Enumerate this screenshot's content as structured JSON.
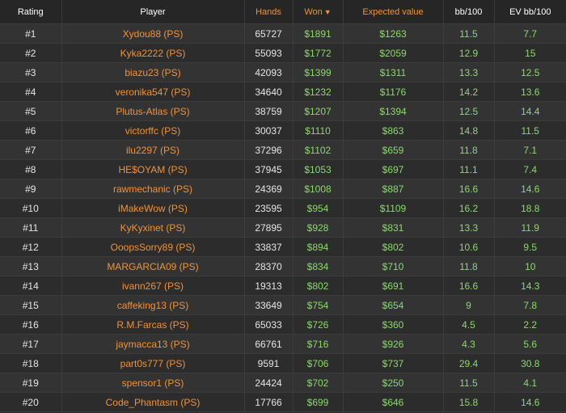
{
  "headers": {
    "rating": "Rating",
    "player": "Player",
    "hands": "Hands",
    "won": "Won",
    "ev": "Expected value",
    "bb100": "bb/100",
    "evbb100": "EV bb/100"
  },
  "sort_arrow_icon": "caret-down-icon",
  "colors": {
    "accent_orange": "#f0923c",
    "value_green": "#8ad96b",
    "background": "#2b2b2b"
  },
  "rows": [
    {
      "rank": "#1",
      "player": "Xydou88 (PS)",
      "hands": "65727",
      "won": "$1891",
      "ev": "$1263",
      "bb": "11.5",
      "evbb": "7.7"
    },
    {
      "rank": "#2",
      "player": "Kyka2222 (PS)",
      "hands": "55093",
      "won": "$1772",
      "ev": "$2059",
      "bb": "12.9",
      "evbb": "15"
    },
    {
      "rank": "#3",
      "player": "biazu23 (PS)",
      "hands": "42093",
      "won": "$1399",
      "ev": "$1311",
      "bb": "13.3",
      "evbb": "12.5"
    },
    {
      "rank": "#4",
      "player": "veronika547 (PS)",
      "hands": "34640",
      "won": "$1232",
      "ev": "$1176",
      "bb": "14.2",
      "evbb": "13.6"
    },
    {
      "rank": "#5",
      "player": "Plutus-Atlas (PS)",
      "hands": "38759",
      "won": "$1207",
      "ev": "$1394",
      "bb": "12.5",
      "evbb": "14.4"
    },
    {
      "rank": "#6",
      "player": "victorffc (PS)",
      "hands": "30037",
      "won": "$1110",
      "ev": "$863",
      "bb": "14.8",
      "evbb": "11.5"
    },
    {
      "rank": "#7",
      "player": "ilu2297 (PS)",
      "hands": "37296",
      "won": "$1102",
      "ev": "$659",
      "bb": "11.8",
      "evbb": "7.1"
    },
    {
      "rank": "#8",
      "player": "HE$OYAM (PS)",
      "hands": "37945",
      "won": "$1053",
      "ev": "$697",
      "bb": "11.1",
      "evbb": "7.4"
    },
    {
      "rank": "#9",
      "player": "rawmechanic (PS)",
      "hands": "24369",
      "won": "$1008",
      "ev": "$887",
      "bb": "16.6",
      "evbb": "14.6"
    },
    {
      "rank": "#10",
      "player": "iMakeWow (PS)",
      "hands": "23595",
      "won": "$954",
      "ev": "$1109",
      "bb": "16.2",
      "evbb": "18.8"
    },
    {
      "rank": "#11",
      "player": "KyKyxinet (PS)",
      "hands": "27895",
      "won": "$928",
      "ev": "$831",
      "bb": "13.3",
      "evbb": "11.9"
    },
    {
      "rank": "#12",
      "player": "OoopsSorry89 (PS)",
      "hands": "33837",
      "won": "$894",
      "ev": "$802",
      "bb": "10.6",
      "evbb": "9.5"
    },
    {
      "rank": "#13",
      "player": "MARGARCIA09 (PS)",
      "hands": "28370",
      "won": "$834",
      "ev": "$710",
      "bb": "11.8",
      "evbb": "10"
    },
    {
      "rank": "#14",
      "player": "ivann267 (PS)",
      "hands": "19313",
      "won": "$802",
      "ev": "$691",
      "bb": "16.6",
      "evbb": "14.3"
    },
    {
      "rank": "#15",
      "player": "caffeking13 (PS)",
      "hands": "33649",
      "won": "$754",
      "ev": "$654",
      "bb": "9",
      "evbb": "7.8"
    },
    {
      "rank": "#16",
      "player": "R.M.Farcas (PS)",
      "hands": "65033",
      "won": "$726",
      "ev": "$360",
      "bb": "4.5",
      "evbb": "2.2"
    },
    {
      "rank": "#17",
      "player": "jaymacca13 (PS)",
      "hands": "66761",
      "won": "$716",
      "ev": "$926",
      "bb": "4.3",
      "evbb": "5.6"
    },
    {
      "rank": "#18",
      "player": "part0s777 (PS)",
      "hands": "9591",
      "won": "$706",
      "ev": "$737",
      "bb": "29.4",
      "evbb": "30.8"
    },
    {
      "rank": "#19",
      "player": "spensor1 (PS)",
      "hands": "24424",
      "won": "$702",
      "ev": "$250",
      "bb": "11.5",
      "evbb": "4.1"
    },
    {
      "rank": "#20",
      "player": "Code_Phantasm (PS)",
      "hands": "17766",
      "won": "$699",
      "ev": "$646",
      "bb": "15.8",
      "evbb": "14.6"
    }
  ]
}
